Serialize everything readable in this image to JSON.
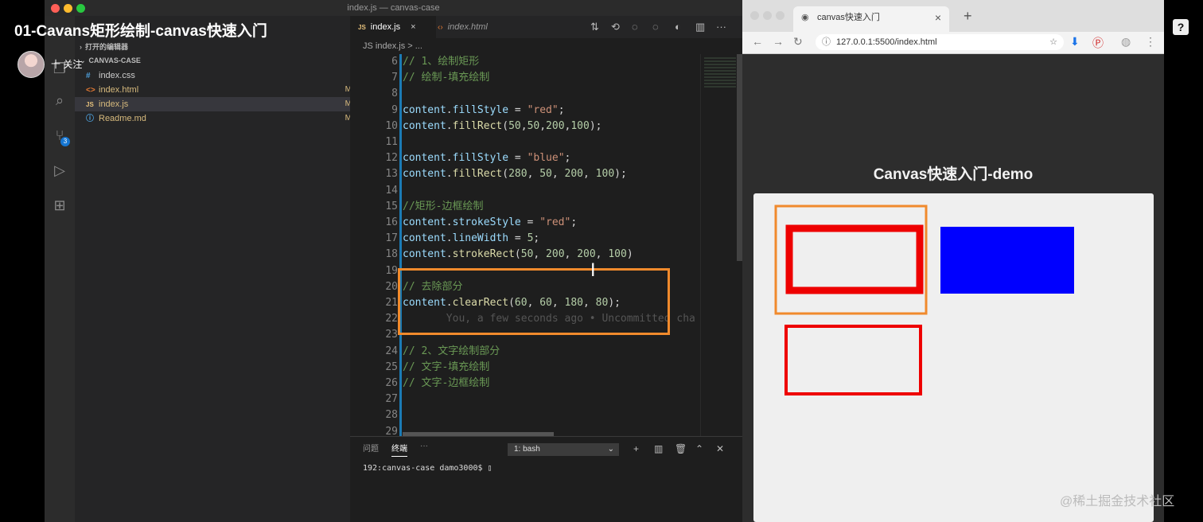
{
  "overlay": {
    "title": "01-Cavans矩形绘制-canvas快速入门",
    "follow_label": "十 关注",
    "help_glyph": "?",
    "watermark": "@稀土掘金技术社区"
  },
  "vscode": {
    "window_title": "index.js — canvas-case",
    "explorer": {
      "open_editors_header": "打开的编辑器",
      "folder_header": "CANVAS-CASE",
      "files": [
        {
          "icon": "#",
          "icon_color": "#4fa3e0",
          "name": "index.css",
          "status": ""
        },
        {
          "icon": "<>",
          "icon_color": "#e37933",
          "name": "index.html",
          "status": "M"
        },
        {
          "icon": "JS",
          "icon_color": "#e5c07b",
          "name": "index.js",
          "status": "M"
        },
        {
          "icon": "ⓘ",
          "icon_color": "#4fa3e0",
          "name": "Readme.md",
          "status": "M"
        }
      ],
      "git_badge": "3"
    },
    "tabs": [
      {
        "label": "index.js",
        "active": true,
        "close": "×"
      },
      {
        "label": "index.html",
        "active": false
      }
    ],
    "breadcrumb": "JS index.js > ...",
    "line_numbers": [
      "6",
      "7",
      "8",
      "9",
      "10",
      "11",
      "12",
      "13",
      "14",
      "15",
      "16",
      "17",
      "18",
      "19",
      "20",
      "21",
      "22",
      "23",
      "24",
      "25",
      "26",
      "27",
      "28",
      "29"
    ],
    "panel": {
      "tabs": [
        "问题",
        "终端",
        "···"
      ],
      "terminal_select": "1: bash",
      "terminal_line": "192:canvas-case damo3000$ ▯"
    }
  },
  "chrome": {
    "tab_title": "canvas快速入门",
    "tab_close": "×",
    "new_tab": "+",
    "url": "127.0.0.1:5500/index.html",
    "page_heading": "Canvas快速入门-demo"
  },
  "colors": {
    "highlight_orange": "#f08a2c",
    "rect_red": "#ee0000",
    "rect_blue": "#0000ff"
  }
}
